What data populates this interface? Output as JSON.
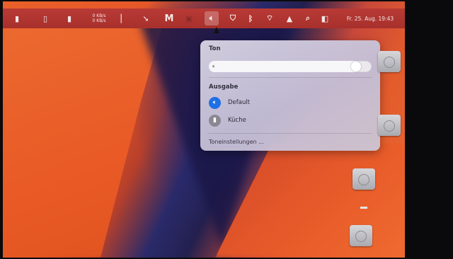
{
  "menubar": {
    "netstat_line1": "0 KB/s",
    "netstat_line2": "0 KB/s",
    "app_icon_m": "M",
    "datetime": "Fr. 25. Aug. 19:43",
    "icons": [
      "cpu-icon",
      "memory-icon",
      "battery-icon",
      "chart-icon",
      "malwarebytes-icon",
      "app-icon",
      "sound-icon",
      "shield-icon",
      "bluetooth-icon",
      "wifi-icon",
      "airplay-icon",
      "search-icon",
      "control-center-icon"
    ]
  },
  "sound_popup": {
    "title": "Ton",
    "volume": 0.93,
    "output_title": "Ausgabe",
    "devices": [
      {
        "label": "Default",
        "selected": true,
        "icon": "speaker-icon"
      },
      {
        "label": "Küche",
        "selected": false,
        "icon": "homepod-icon"
      }
    ],
    "settings_link": "Toneinstellungen ..."
  },
  "colors": {
    "menubar": "#b83a36",
    "accent": "#1f6fe6",
    "wallpaper_orange": "#e85c2a",
    "wallpaper_dark": "#23204f"
  }
}
